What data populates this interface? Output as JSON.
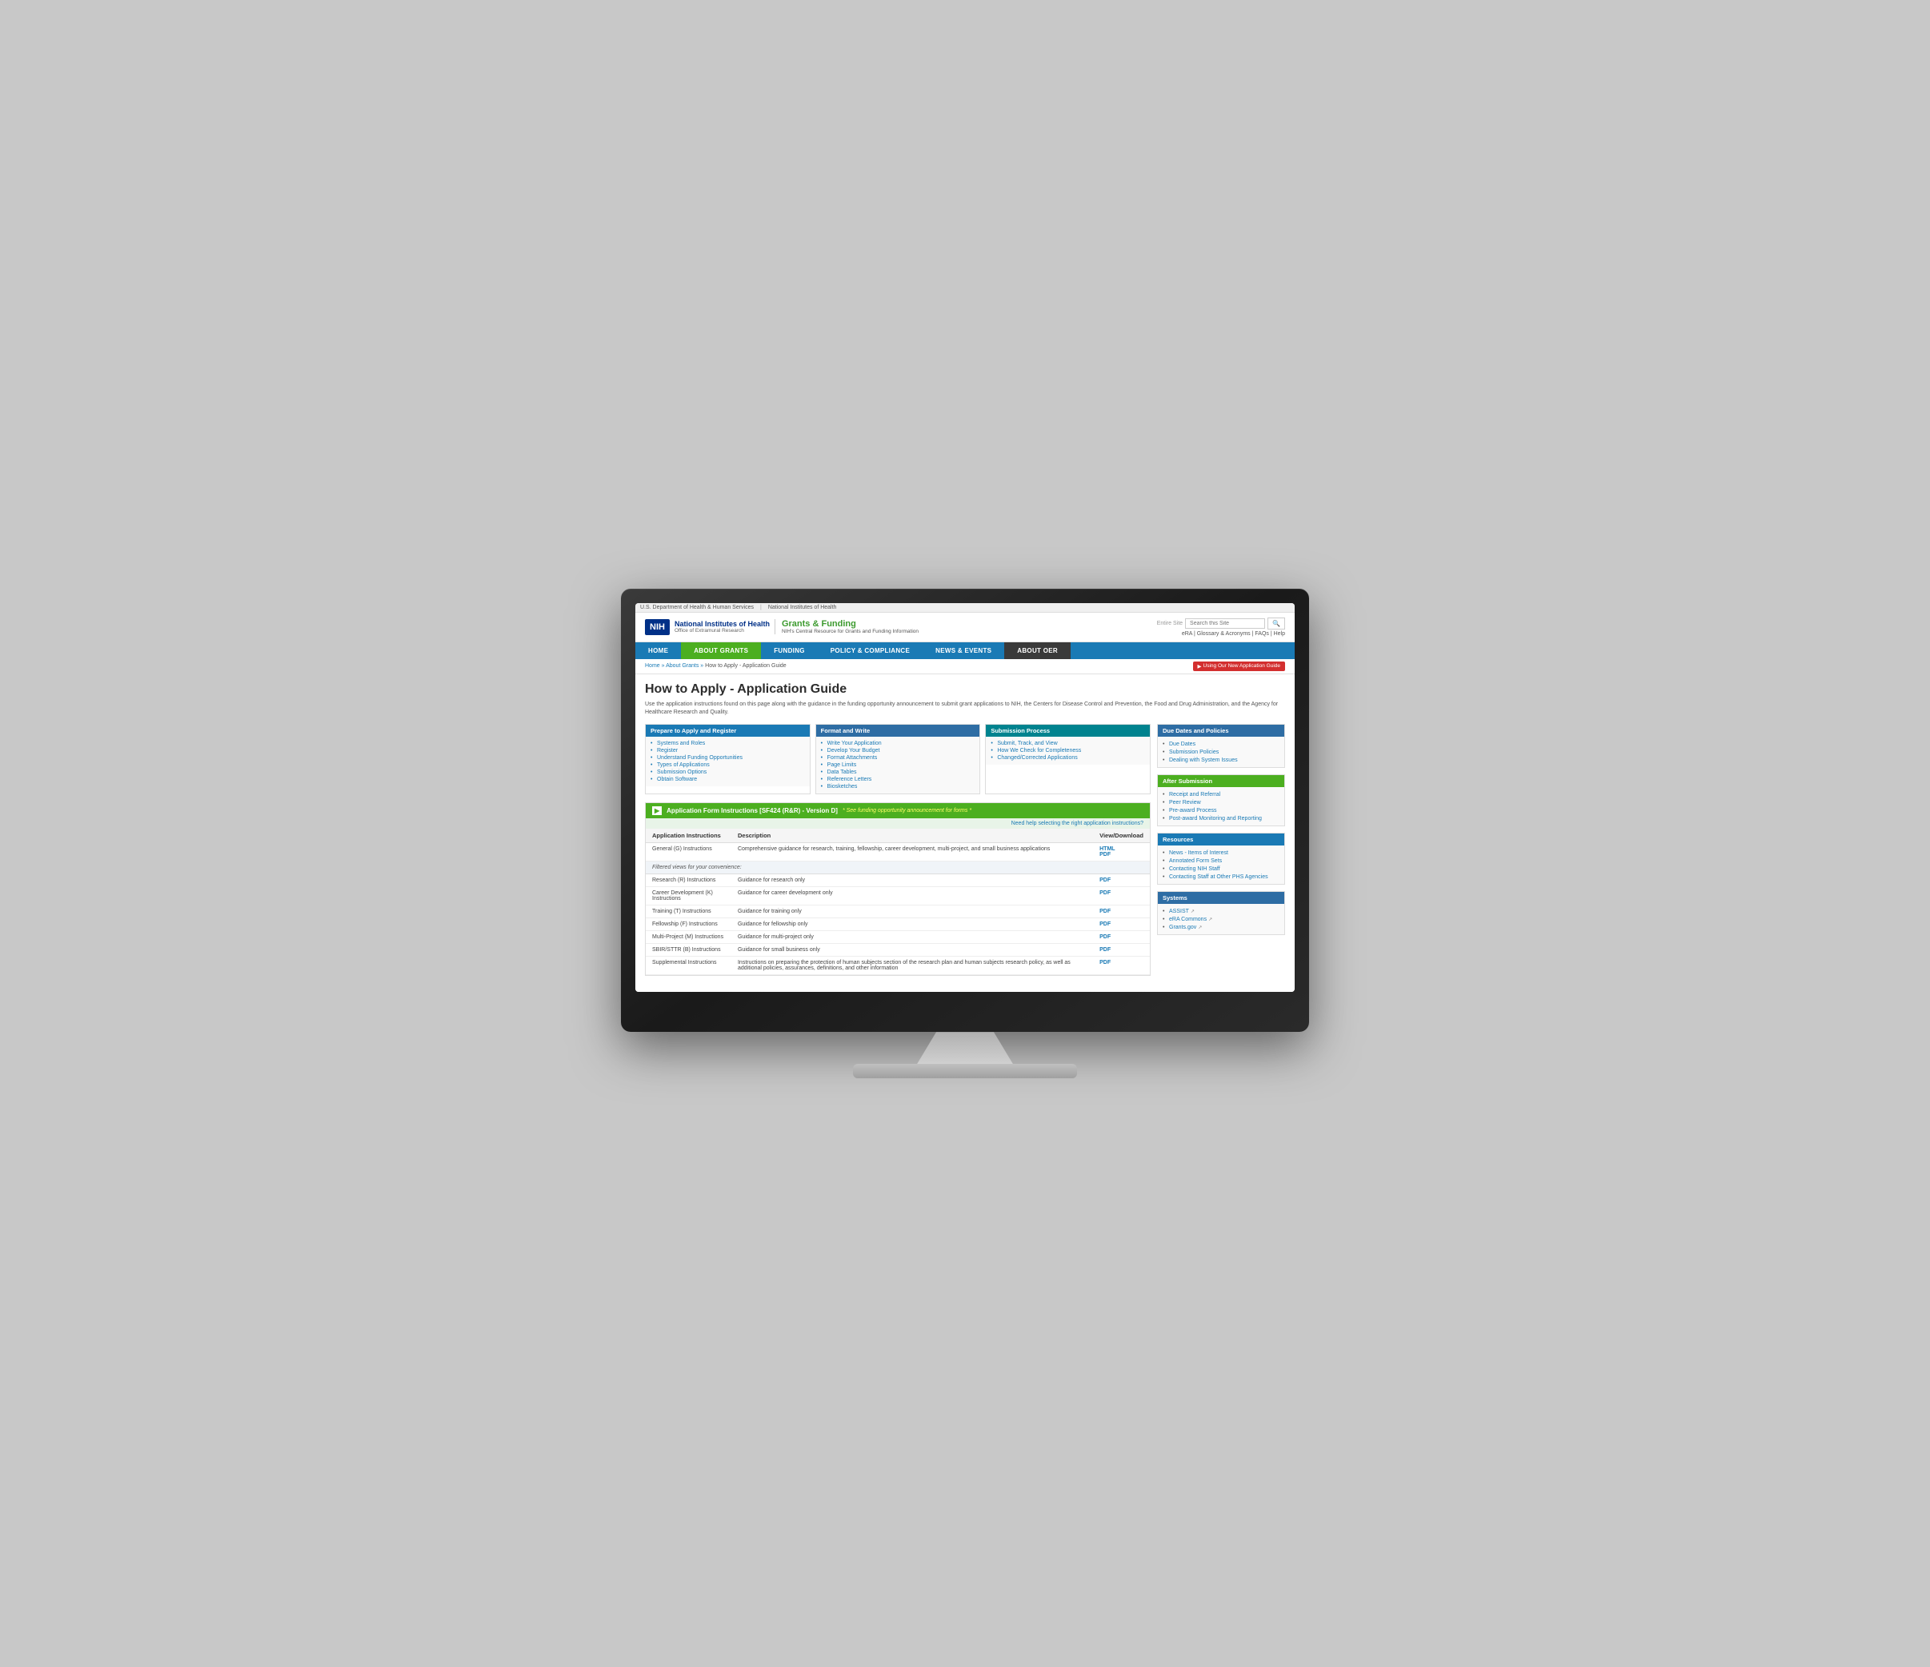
{
  "browser": {
    "top_bar": {
      "dept": "U.S. Department of Health & Human Services",
      "nih": "National Institutes of Health"
    }
  },
  "header": {
    "nih_badge": "NIH",
    "nih_title": "National Institutes of Health",
    "nih_subtitle": "Office of Extramural Research",
    "grants_title": "Grants & Funding",
    "grants_subtitle": "NIH's Central Resource for Grants and Funding Information",
    "search_placeholder": "Entire Site",
    "search_placeholder2": "Search this Site",
    "header_links": "eRA | Glossary & Acronyms | FAQs | Help"
  },
  "nav": {
    "items": [
      {
        "label": "HOME",
        "active": false
      },
      {
        "label": "ABOUT GRANTS",
        "active": true,
        "style": "green"
      },
      {
        "label": "FUNDING",
        "active": false
      },
      {
        "label": "POLICY & COMPLIANCE",
        "active": false
      },
      {
        "label": "NEWS & EVENTS",
        "active": false
      },
      {
        "label": "ABOUT OER",
        "active": false,
        "style": "dark"
      }
    ]
  },
  "breadcrumb": {
    "items": [
      "Home",
      "About Grants",
      "How to Apply - Application Guide"
    ],
    "separator": "»",
    "using_app_btn": "Using Our New Application Guide"
  },
  "page": {
    "title": "How to Apply - Application Guide",
    "description": "Use the application instructions found on this page along with the guidance in the funding opportunity announcement to submit grant applications to NIH, the Centers for Disease Control and Prevention, the Food and Drug Administration, and the Agency for Healthcare Research and Quality."
  },
  "info_boxes": [
    {
      "id": "prepare",
      "header": "Prepare to Apply and Register",
      "header_style": "blue",
      "items": [
        "Systems and Roles",
        "Register",
        "Understand Funding Opportunities",
        "Types of Applications",
        "Submission Options",
        "Obtain Software"
      ]
    },
    {
      "id": "format",
      "header": "Format and Write",
      "header_style": "dark-blue",
      "items": [
        "Write Your Application",
        "Develop Your Budget",
        "Format Attachments",
        "Page Limits",
        "Data Tables",
        "Reference Letters",
        "Biosketches"
      ]
    },
    {
      "id": "submission",
      "header": "Submission Process",
      "header_style": "teal",
      "items": [
        "Submit, Track, and View",
        "How We Check for Completeness",
        "Changed/Corrected Applications"
      ]
    }
  ],
  "app_form": {
    "header": "Application Form Instructions [SF424 (R&R) - Version D]",
    "header_link": "* See funding opportunity announcement for forms *",
    "help_text": "Need help selecting the right application instructions?",
    "columns": [
      "Application Instructions",
      "Description",
      "View/Download"
    ],
    "general_row": {
      "label": "General (G) Instructions",
      "description": "Comprehensive guidance for research, training, fellowship, career development, multi-project, and small business applications",
      "links": [
        "HTML",
        "PDF"
      ]
    },
    "filtered_label": "Filtered views for your convenience:",
    "filtered_rows": [
      {
        "label": "Research (R) Instructions",
        "description": "Guidance for research only",
        "link": "PDF"
      },
      {
        "label": "Career Development (K) Instructions",
        "description": "Guidance for career development only",
        "link": "PDF"
      },
      {
        "label": "Training (T) Instructions",
        "description": "Guidance for training only",
        "link": "PDF"
      },
      {
        "label": "Fellowship (F) Instructions",
        "description": "Guidance for fellowship only",
        "link": "PDF"
      },
      {
        "label": "Multi-Project (M) Instructions",
        "description": "Guidance for multi-project only",
        "link": "PDF"
      },
      {
        "label": "SBIR/STTR (B) Instructions",
        "description": "Guidance for small business only",
        "link": "PDF"
      }
    ],
    "supplemental_row": {
      "label": "Supplemental Instructions",
      "description": "Instructions on preparing the protection of human subjects section of the research plan and human subjects research policy, as well as additional policies, assurances, definitions, and other information",
      "link": "PDF"
    }
  },
  "sidebar": {
    "due_dates": {
      "header": "Due Dates and Policies",
      "items": [
        "Due Dates",
        "Submission Policies",
        "Dealing with System Issues"
      ]
    },
    "after_submission": {
      "header": "After Submission",
      "items": [
        "Receipt and Referral",
        "Peer Review",
        "Pre-award Process",
        "Post-award Monitoring and Reporting"
      ]
    },
    "resources": {
      "header": "Resources",
      "items": [
        "News - Items of Interest",
        "Annotated Form Sets",
        "Contacting NIH Staff",
        "Contacting Staff at Other PHS Agencies"
      ]
    },
    "systems": {
      "header": "Systems",
      "items": [
        "ASSIST ↗",
        "eRA Commons ↗",
        "Grants.gov ↗"
      ]
    }
  }
}
